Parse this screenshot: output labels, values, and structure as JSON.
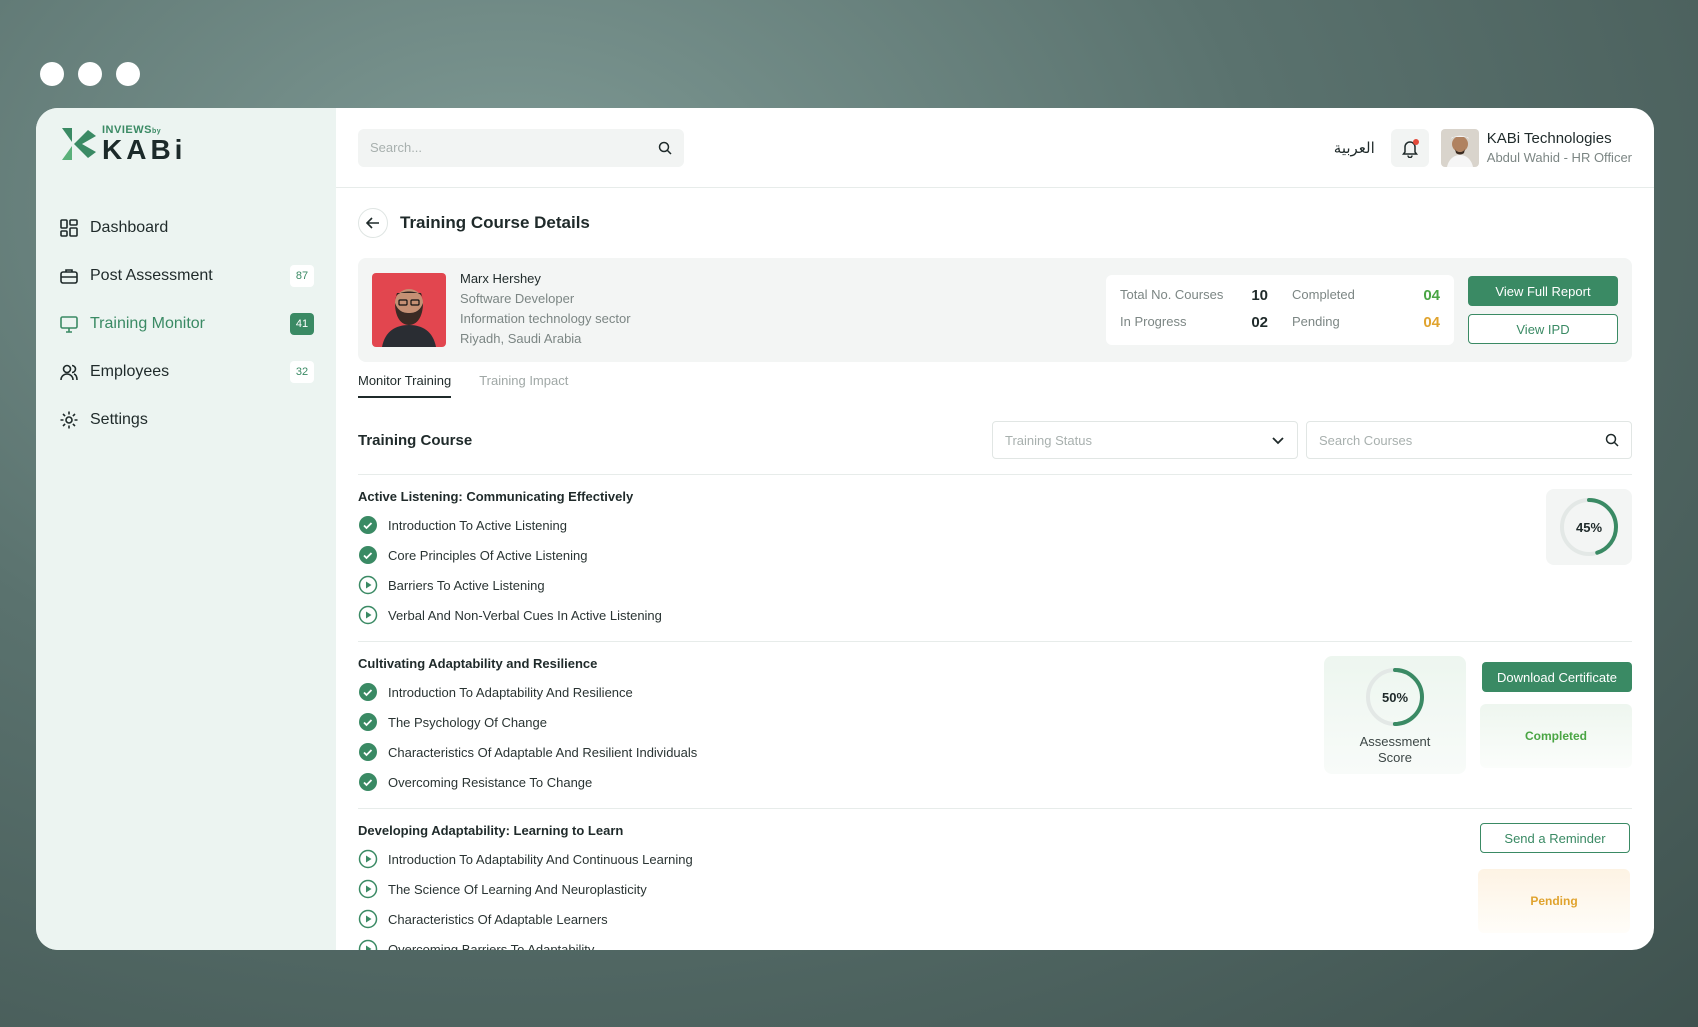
{
  "brand": {
    "top": "INVIEWS",
    "by": "by",
    "main": "KABi"
  },
  "sidebar": {
    "items": [
      {
        "label": "Dashboard",
        "badge": ""
      },
      {
        "label": "Post Assessment",
        "badge": "87"
      },
      {
        "label": "Training Monitor",
        "badge": "41"
      },
      {
        "label": "Employees",
        "badge": "32"
      },
      {
        "label": "Settings",
        "badge": ""
      }
    ]
  },
  "topbar": {
    "search_placeholder": "Search...",
    "language": "العربية",
    "company": "KABi Technologies",
    "user": "Abdul Wahid - HR Officer"
  },
  "page": {
    "title": "Training Course Details"
  },
  "employee": {
    "name": "Marx Hershey",
    "role": "Software Developer",
    "sector": "Information technology sector",
    "location": "Riyadh, Saudi Arabia"
  },
  "stats": {
    "total_label": "Total No. Courses",
    "total": "10",
    "completed_label": "Completed",
    "completed": "04",
    "inprogress_label": "In Progress",
    "inprogress": "02",
    "pending_label": "Pending",
    "pending": "04"
  },
  "actions": {
    "full_report": "View Full Report",
    "ipd": "View IPD"
  },
  "tabs": [
    "Monitor Training",
    "Training Impact"
  ],
  "courses_header": {
    "title": "Training Course",
    "status_placeholder": "Training Status",
    "search_placeholder": "Search Courses"
  },
  "courses": [
    {
      "title": "Active Listening: Communicating Effectively",
      "progress": "45%",
      "lessons": [
        {
          "label": "Introduction To Active Listening",
          "done": true
        },
        {
          "label": "Core Principles Of Active Listening",
          "done": true
        },
        {
          "label": "Barriers To Active Listening",
          "done": false
        },
        {
          "label": "Verbal And Non-Verbal Cues In Active Listening",
          "done": false
        }
      ]
    },
    {
      "title": "Cultivating Adaptability and Resilience",
      "score": "50%",
      "score_label": "Assessment Score",
      "button": "Download Certificate",
      "status": "Completed",
      "lessons": [
        {
          "label": "Introduction To Adaptability And Resilience",
          "done": true
        },
        {
          "label": "The Psychology Of Change",
          "done": true
        },
        {
          "label": "Characteristics Of Adaptable And Resilient Individuals",
          "done": true
        },
        {
          "label": "Overcoming Resistance To Change",
          "done": true
        }
      ]
    },
    {
      "title": "Developing Adaptability: Learning to Learn",
      "button": "Send a Reminder",
      "status": "Pending",
      "lessons": [
        {
          "label": "Introduction To Adaptability And Continuous Learning",
          "done": false
        },
        {
          "label": "The Science Of Learning And Neuroplasticity",
          "done": false
        },
        {
          "label": "Characteristics Of Adaptable Learners",
          "done": false
        },
        {
          "label": "Overcoming Barriers To Adaptability",
          "done": false
        }
      ]
    }
  ],
  "colors": {
    "accent": "#3a8a64",
    "completed": "#4aa544",
    "pending": "#e0a32e"
  }
}
